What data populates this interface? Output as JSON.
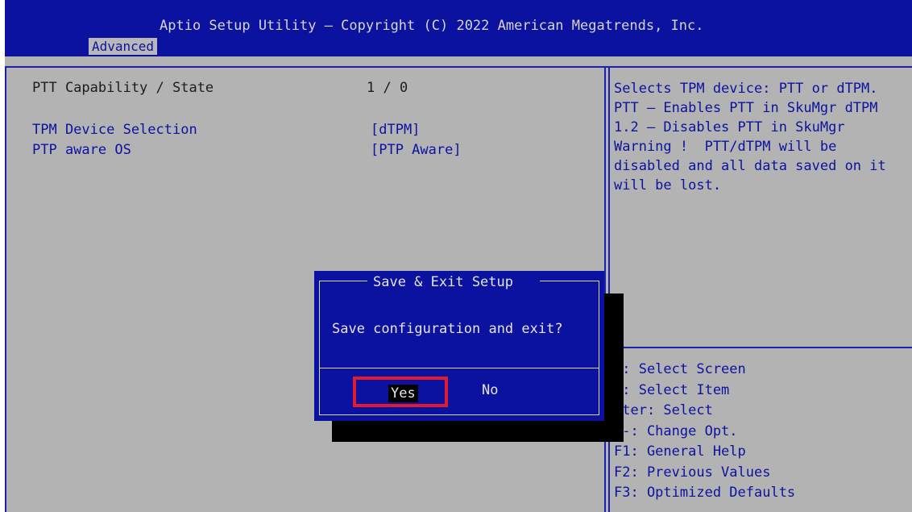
{
  "header": {
    "title": "Aptio Setup Utility – Copyright (C) 2022 American Megatrends, Inc.",
    "active_tab": "Advanced"
  },
  "settings": [
    {
      "label": "PTT Capability / State",
      "value": "1 / 0",
      "selectable": false
    },
    {
      "label": "TPM Device Selection",
      "value": "[dTPM]",
      "selectable": true
    },
    {
      "label": "PTP aware OS",
      "value": "[PTP Aware]",
      "selectable": true
    }
  ],
  "help": {
    "text": "Selects TPM device: PTT or dTPM. PTT – Enables PTT in SkuMgr dTPM 1.2 – Disables PTT in SkuMgr Warning !  PTT/dTPM will be disabled and all data saved on it will be lost."
  },
  "keys": [
    "←: Select Screen",
    "↓: Select Item",
    "nter: Select",
    "/-: Change Opt.",
    "F1: General Help",
    "F2: Previous Values",
    "F3: Optimized Defaults"
  ],
  "dialog": {
    "title": "Save & Exit Setup",
    "message": "Save configuration and exit?",
    "yes_label": "Yes",
    "no_label": "No"
  },
  "colors": {
    "bios_blue": "#0c12a0",
    "bios_gray": "#b3b3b3",
    "highlight_red": "#e21a30"
  }
}
